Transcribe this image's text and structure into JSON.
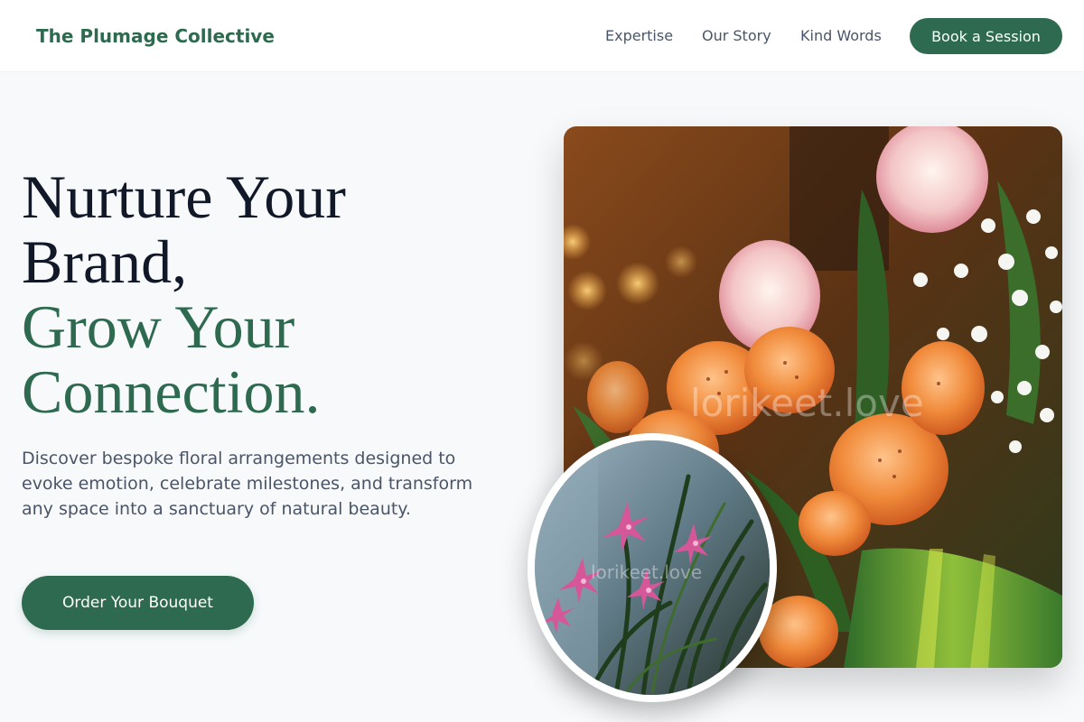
{
  "header": {
    "brand": "The Plumage Collective",
    "nav": [
      {
        "label": "Expertise"
      },
      {
        "label": "Our Story"
      },
      {
        "label": "Kind Words"
      }
    ],
    "cta_label": "Book a Session"
  },
  "hero": {
    "headline_lines": [
      "Nurture Your",
      "Brand,"
    ],
    "headline_accent_lines": [
      "Grow Your",
      "Connection."
    ],
    "description": "Discover bespoke floral arrangements designed to evoke emotion, celebrate milestones, and transform any space into a sanctuary of natural beauty.",
    "cta_label": "Order Your Bouquet"
  },
  "images": {
    "main_watermark": "lorikeet.love",
    "circle_watermark": "lorikeet.love"
  },
  "colors": {
    "brand_green": "#2d6a4f",
    "text_dark": "#111827",
    "text_muted": "#4a5568",
    "background": "#f7f9fb"
  }
}
